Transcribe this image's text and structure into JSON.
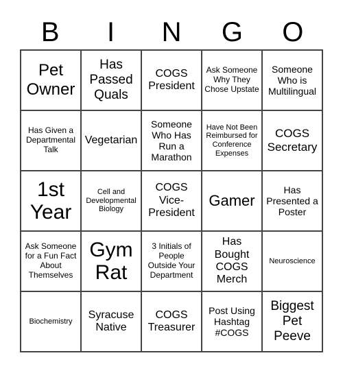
{
  "header": {
    "letters": [
      "B",
      "I",
      "N",
      "G",
      "O"
    ]
  },
  "cells": [
    "Pet Owner",
    "Has Passed Quals",
    "COGS President",
    "Ask Someone Why They Chose Upstate",
    "Someone Who is Multilingual",
    "Has Given a Departmental Talk",
    "Vegetarian",
    "Someone Who Has Run a Marathon",
    "Have Not Been Reimbursed for Conference Expenses",
    "COGS Secretary",
    "1st Year",
    "Cell and Developmental Biology",
    "COGS Vice-President",
    "Gamer",
    "Has Presented a Poster",
    "Ask Someone for a Fun Fact About Themselves",
    "Gym Rat",
    "3 Initials of People Outside Your Department",
    "Has Bought COGS Merch",
    "Neuroscience",
    "Biochemistry",
    "Syracuse Native",
    "COGS Treasurer",
    "Post Using Hashtag #COGS",
    "Biggest Pet Peeve"
  ]
}
